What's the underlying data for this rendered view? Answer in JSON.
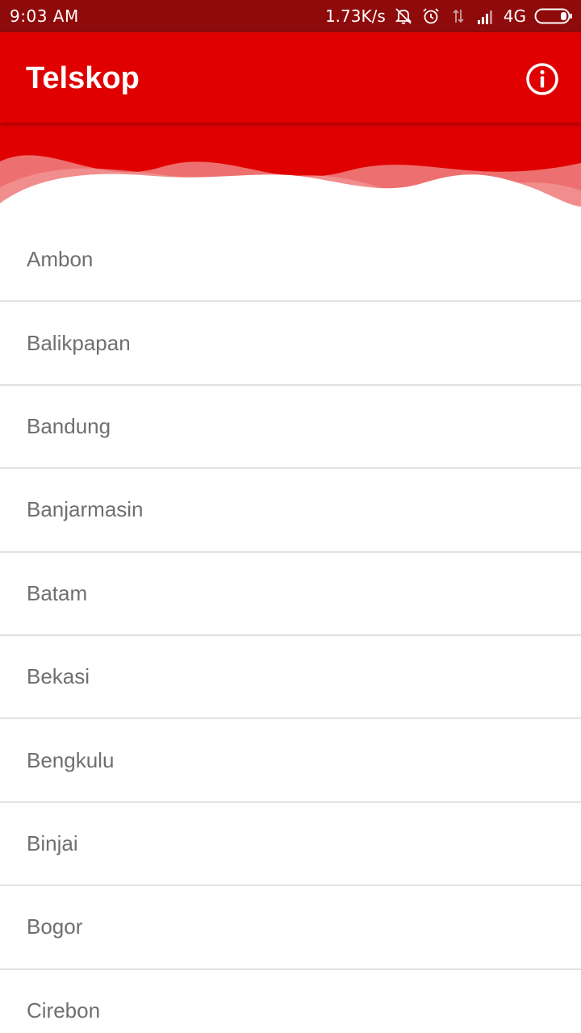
{
  "status_bar": {
    "time": "9:03  AM",
    "net_speed": "1.73K/s",
    "network_type": "4G",
    "icons": [
      "mute-icon",
      "alarm-icon",
      "data-transfer-icon",
      "signal-icon",
      "battery-icon"
    ]
  },
  "app_bar": {
    "title": "Telskop",
    "info_icon": "info-icon",
    "background": "#e00000"
  },
  "cities": [
    "Ambon",
    "Balikpapan",
    "Bandung",
    "Banjarmasin",
    "Batam",
    "Bekasi",
    "Bengkulu",
    "Binjai",
    "Bogor",
    "Cirebon"
  ],
  "colors": {
    "accent": "#e00000",
    "status_bar": "#8f0a0a",
    "list_text": "#6f6f6f",
    "divider": "#e2e2e2"
  }
}
